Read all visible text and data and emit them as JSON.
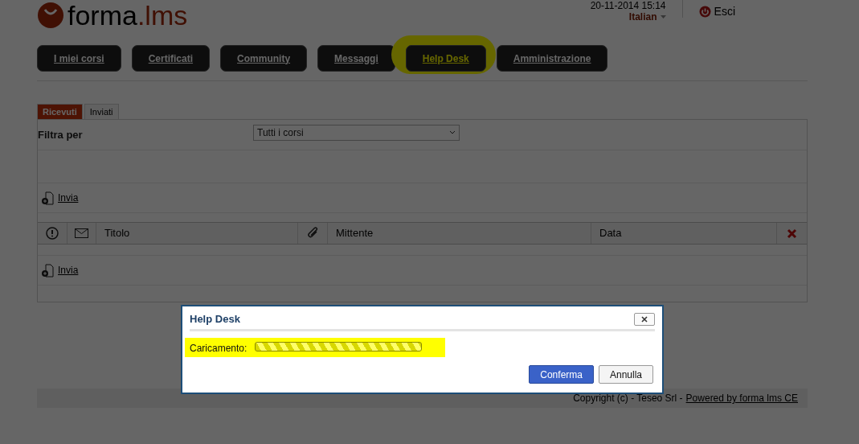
{
  "header": {
    "logo": {
      "word": "forma",
      "suffix": ".lms"
    },
    "datetime": "20-11-2014 15:14",
    "language": "Italian",
    "logout": "Esci"
  },
  "nav": [
    {
      "label": "I miei corsi",
      "highlighted": false
    },
    {
      "label": "Certificati",
      "highlighted": false
    },
    {
      "label": "Community",
      "highlighted": false
    },
    {
      "label": "Messaggi",
      "highlighted": false
    },
    {
      "label": "Help Desk",
      "highlighted": true
    },
    {
      "label": "Amministrazione",
      "highlighted": false
    }
  ],
  "tabs": [
    {
      "label": "Ricevuti",
      "selected": true
    },
    {
      "label": "Inviati",
      "selected": false
    }
  ],
  "filter": {
    "label": "Filtra per",
    "value": "Tutti i corsi"
  },
  "send_links": [
    "Invia",
    "Invia"
  ],
  "table": {
    "columns": [
      {
        "kind": "priority-icon"
      },
      {
        "kind": "envelope-icon"
      },
      {
        "kind": "text",
        "label": "Titolo"
      },
      {
        "kind": "clip-icon"
      },
      {
        "kind": "text",
        "label": "Mittente"
      },
      {
        "kind": "text",
        "label": "Data"
      },
      {
        "kind": "delete-icon"
      }
    ]
  },
  "footer": {
    "copyright": "Copyright (c) - Teseo Srl -",
    "link": "Powered by forma lms CE"
  },
  "dialog": {
    "title": "Help Desk",
    "loading_label": "Caricamento:",
    "highlighted": true,
    "buttons": [
      {
        "label": "Conferma",
        "primary": true
      },
      {
        "label": "Annulla",
        "primary": false
      }
    ]
  }
}
